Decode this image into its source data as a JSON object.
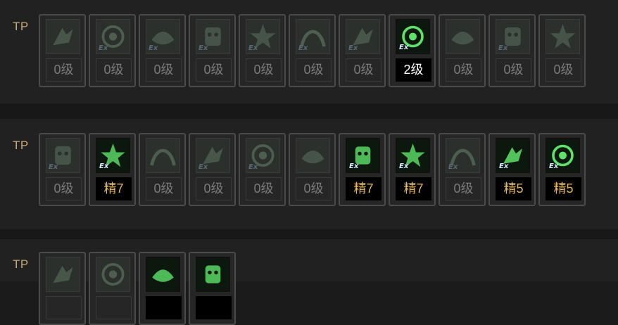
{
  "rows": [
    {
      "tp_label": "TP",
      "slots": [
        {
          "icon": "dash-strike-icon",
          "ex": false,
          "level": "0级",
          "state": "inactive"
        },
        {
          "icon": "spiral-swing-icon",
          "ex": true,
          "level": "0级",
          "state": "inactive"
        },
        {
          "icon": "comet-star-icon",
          "ex": true,
          "level": "0级",
          "state": "inactive"
        },
        {
          "icon": "summon-creature-icon",
          "ex": true,
          "level": "0级",
          "state": "inactive"
        },
        {
          "icon": "orbit-spheres-icon",
          "ex": true,
          "level": "0级",
          "state": "inactive"
        },
        {
          "icon": "crawling-beast-icon",
          "ex": true,
          "level": "0级",
          "state": "inactive"
        },
        {
          "icon": "whip-curl-icon",
          "ex": true,
          "level": "0级",
          "state": "inactive"
        },
        {
          "icon": "energy-orb-icon",
          "ex": true,
          "level": "2级",
          "state": "active"
        },
        {
          "icon": "slash-wave-icon",
          "ex": false,
          "level": "0级",
          "state": "inactive"
        },
        {
          "icon": "puppet-doll-icon",
          "ex": true,
          "level": "0级",
          "state": "inactive"
        },
        {
          "icon": "lash-rope-icon",
          "ex": false,
          "level": "0级",
          "state": "inactive"
        }
      ]
    },
    {
      "tp_label": "TP",
      "slots": [
        {
          "icon": "grasp-hand-icon",
          "ex": true,
          "level": "0级",
          "state": "inactive"
        },
        {
          "icon": "witch-hat-icon",
          "ex": true,
          "level": "精7",
          "state": "elite"
        },
        {
          "icon": "spinning-blade-icon",
          "ex": false,
          "level": "0级",
          "state": "inactive"
        },
        {
          "icon": "shatter-burst-icon",
          "ex": true,
          "level": "0级",
          "state": "inactive"
        },
        {
          "icon": "net-racket-icon",
          "ex": true,
          "level": "0级",
          "state": "inactive"
        },
        {
          "icon": "hypno-swirl-icon",
          "ex": false,
          "level": "0级",
          "state": "inactive"
        },
        {
          "icon": "potion-flask-icon",
          "ex": true,
          "level": "精7",
          "state": "elite"
        },
        {
          "icon": "storm-cloud-icon",
          "ex": true,
          "level": "精7",
          "state": "elite"
        },
        {
          "icon": "crescent-slash-icon",
          "ex": true,
          "level": "0级",
          "state": "inactive"
        },
        {
          "icon": "pumpkin-spirit-icon",
          "ex": true,
          "level": "精5",
          "state": "elite"
        },
        {
          "icon": "poison-splash-icon",
          "ex": true,
          "level": "精5",
          "state": "elite"
        }
      ]
    },
    {
      "tp_label": "TP",
      "slots": [
        {
          "icon": "wind-gust-icon",
          "ex": false,
          "level": "",
          "state": "inactive"
        },
        {
          "icon": "summon-totem-icon",
          "ex": false,
          "level": "",
          "state": "inactive"
        },
        {
          "icon": "grid-net-icon",
          "ex": false,
          "level": "",
          "state": "elite"
        },
        {
          "icon": "skull-blast-icon",
          "ex": false,
          "level": "",
          "state": "elite"
        }
      ]
    }
  ],
  "colors": {
    "tp_label": "#c6a975",
    "active_level_text": "#ffffff",
    "elite_level_text": "#e3b85a",
    "inactive_level_text": "#7b7b7b",
    "active_icon_glow": "#5fe26a",
    "inactive_icon": "#4d5d50"
  }
}
